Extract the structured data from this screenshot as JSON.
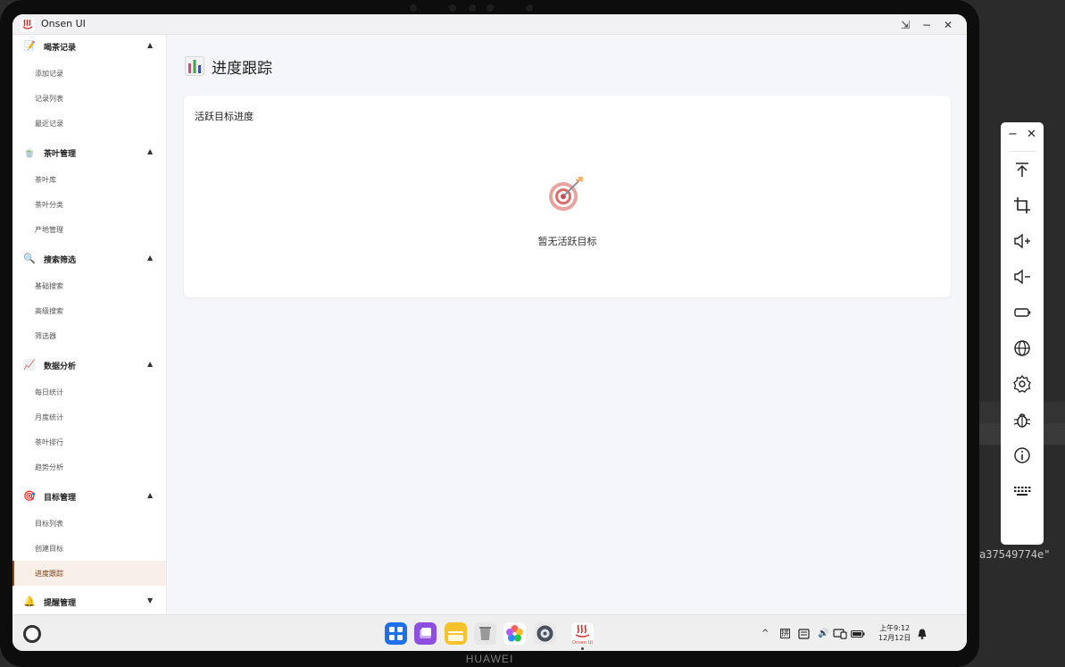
{
  "window": {
    "title": "Onsen UI",
    "restore_label": "⇲",
    "minimize_label": "−",
    "close_label": "✕"
  },
  "device": {
    "brand": "HUAWEI"
  },
  "background": {
    "code_fragment": "a37549774e\""
  },
  "sidebar": {
    "groups": [
      {
        "icon": "📝",
        "icon_name": "memo-icon",
        "label": "喝茶记录",
        "expanded": true,
        "items": [
          "添加记录",
          "记录列表",
          "最近记录"
        ]
      },
      {
        "icon": "🍵",
        "icon_name": "tea-bowl-icon",
        "label": "茶叶管理",
        "expanded": true,
        "items": [
          "茶叶库",
          "茶叶分类",
          "产地管理"
        ]
      },
      {
        "icon": "🔍",
        "icon_name": "search-icon",
        "label": "搜索筛选",
        "expanded": true,
        "items": [
          "基础搜索",
          "高级搜索",
          "筛选器"
        ]
      },
      {
        "icon": "📈",
        "icon_name": "chart-icon",
        "label": "数据分析",
        "expanded": true,
        "items": [
          "每日统计",
          "月度统计",
          "茶叶排行",
          "趋势分析"
        ]
      },
      {
        "icon": "🎯",
        "icon_name": "target-icon",
        "label": "目标管理",
        "expanded": true,
        "items": [
          "目标列表",
          "创建目标",
          "进度跟踪"
        ]
      },
      {
        "icon": "🔔",
        "icon_name": "bell-icon",
        "label": "提醒管理",
        "expanded": false,
        "items": []
      }
    ],
    "active_item": "进度跟踪",
    "caret_up": "▲",
    "caret_down": "▼"
  },
  "main": {
    "page_title": "进度跟踪",
    "card": {
      "title": "活跃目标进度",
      "empty_text": "暂无活跃目标"
    }
  },
  "taskbar": {
    "tray": {
      "caret": "^",
      "ime": "拼",
      "volume": "🔊"
    },
    "clock_time": "上午9:12",
    "clock_date": "12月12日",
    "dock_app_label": "Onsen UI"
  },
  "colors": {
    "accent": "#8b4a1f",
    "active_bg": "#f7efe8",
    "screen_bg": "#f5f6fa"
  }
}
